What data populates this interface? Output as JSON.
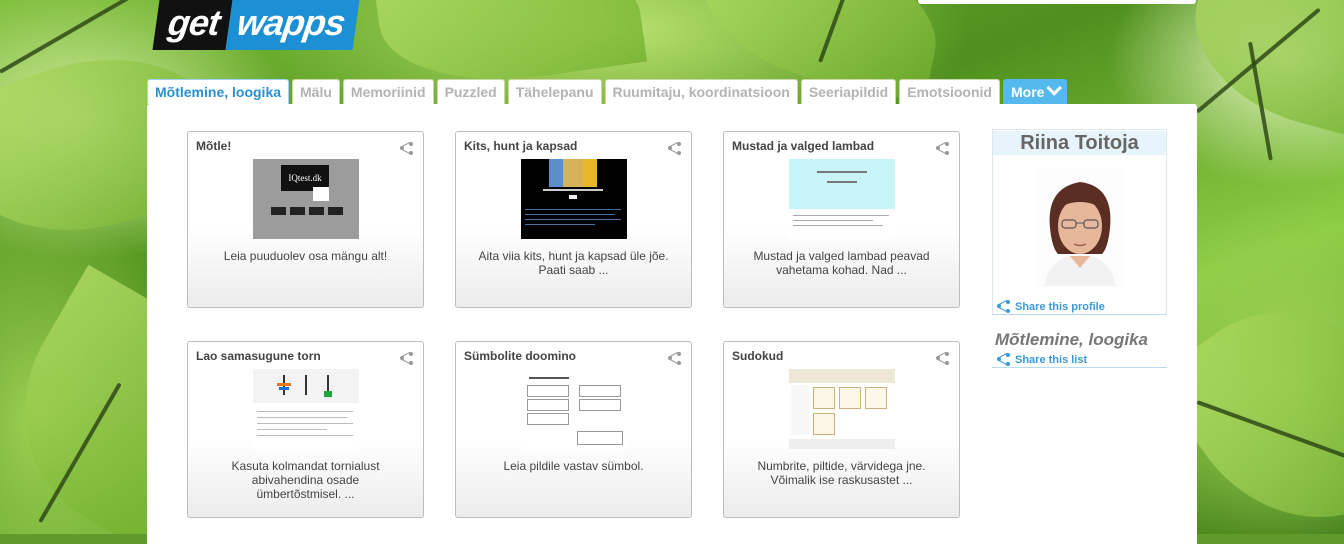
{
  "brand": {
    "logo_get": "get",
    "logo_wapps": "wapps"
  },
  "tabs": [
    {
      "label": "Mõtlemine, loogika",
      "active": true
    },
    {
      "label": "Mälu"
    },
    {
      "label": "Memoriinid"
    },
    {
      "label": "Puzzled"
    },
    {
      "label": "Tähelepanu"
    },
    {
      "label": "Ruumitaju, koordinatsioon"
    },
    {
      "label": "Seeriapildid"
    },
    {
      "label": "Emotsioonid"
    },
    {
      "label": "More"
    }
  ],
  "cards": [
    {
      "title": "Mõtle!",
      "desc": "Leia puuduolev osa mängu alt!",
      "thumb_text": "IQtest.dk"
    },
    {
      "title": "Kits, hunt ja kapsad",
      "desc": "Aita viia kits, hunt ja kapsad üle jõe. Paati saab ..."
    },
    {
      "title": "Mustad ja valged lambad",
      "desc": "Mustad ja valged lambad peavad vahetama kohad. Nad ..."
    },
    {
      "title": "Lao samasugune torn",
      "desc": "Kasuta kolmandat tornialust abivahendina osade ümbertõstmisel. ..."
    },
    {
      "title": "Sümbolite doomino",
      "desc": "Leia pildile vastav sümbol."
    },
    {
      "title": "Sudokud",
      "desc": "Numbrite, piltide, värvidega jne. Võimalik ise raskusastet ..."
    }
  ],
  "profile": {
    "name": "Riina Toitoja",
    "share_profile": "Share this profile"
  },
  "list": {
    "title": "Mõtlemine, loogika",
    "share_list": "Share this list"
  },
  "colors": {
    "accent": "#2a8fd0",
    "more_tab": "#56b9ee",
    "logo_blue": "#1d8fd4"
  }
}
